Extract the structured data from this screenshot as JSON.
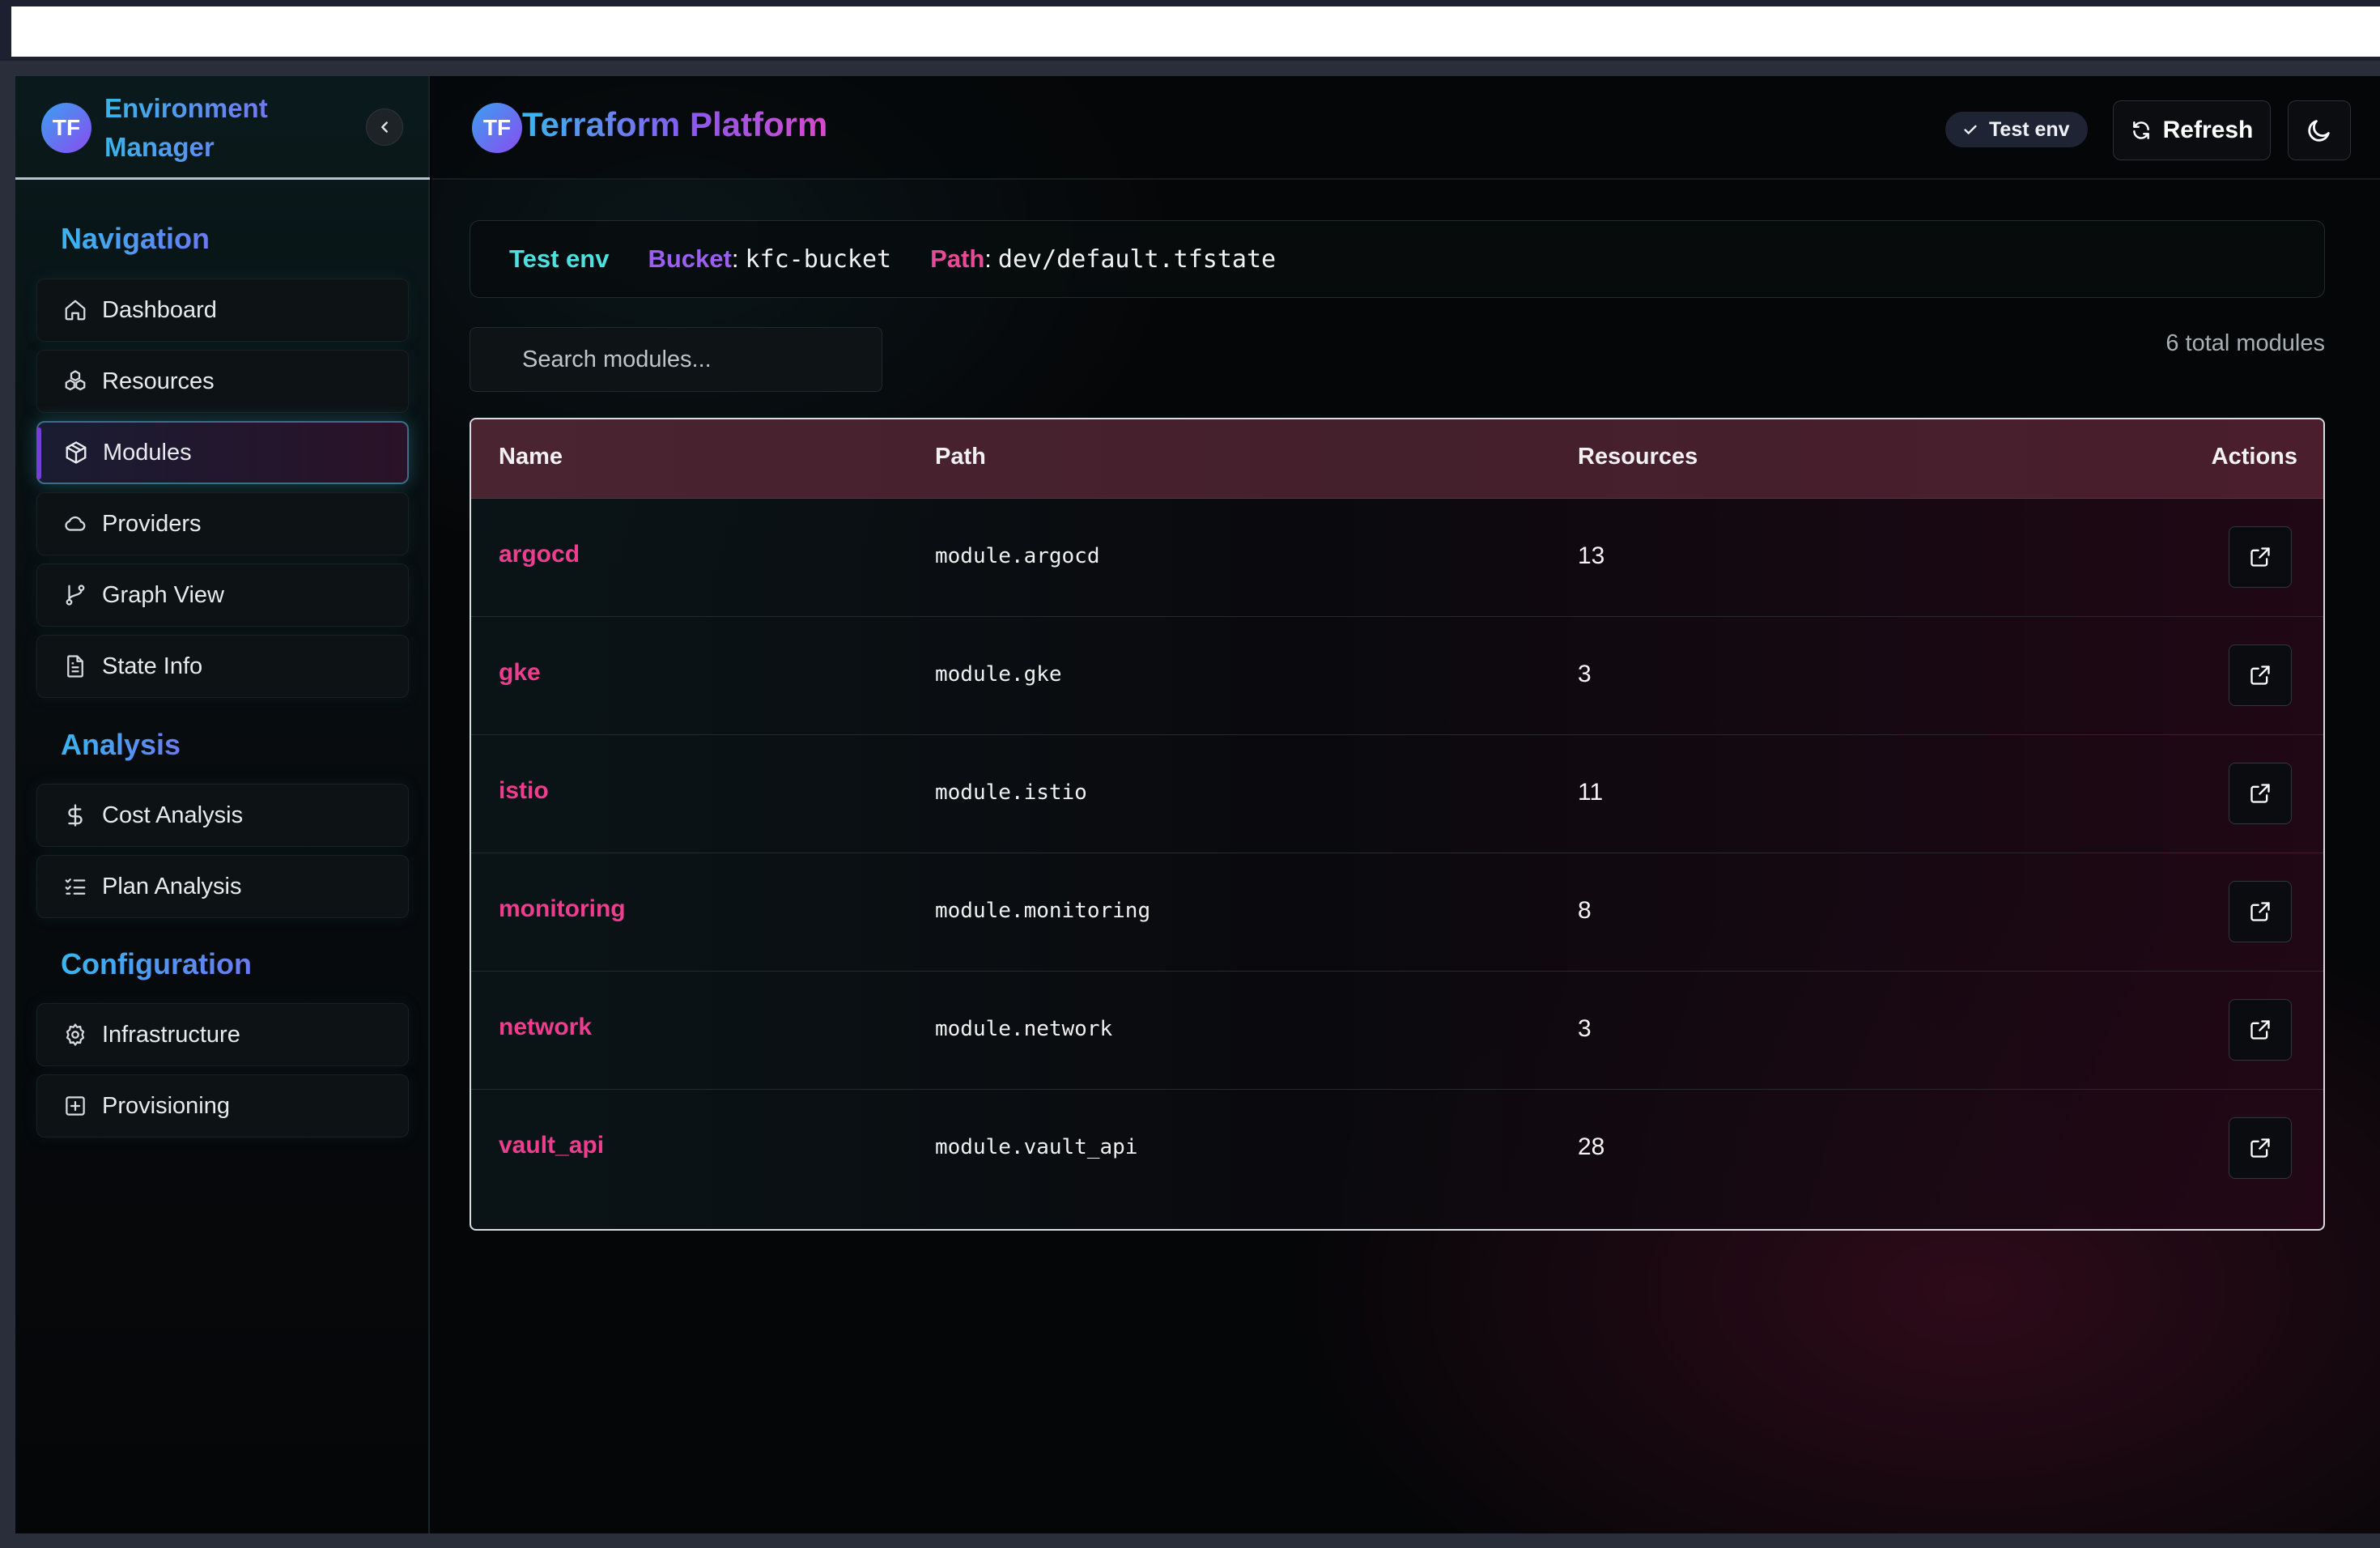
{
  "sidebar": {
    "logo_text": "TF",
    "title": "Environment Manager",
    "sections": [
      {
        "title": "Navigation",
        "items": [
          {
            "label": "Dashboard",
            "icon": "home-icon"
          },
          {
            "label": "Resources",
            "icon": "boxes-icon"
          },
          {
            "label": "Modules",
            "icon": "package-icon",
            "active": true
          },
          {
            "label": "Providers",
            "icon": "cloud-icon"
          },
          {
            "label": "Graph View",
            "icon": "git-branch-icon"
          },
          {
            "label": "State Info",
            "icon": "file-text-icon"
          }
        ]
      },
      {
        "title": "Analysis",
        "items": [
          {
            "label": "Cost Analysis",
            "icon": "dollar-icon"
          },
          {
            "label": "Plan Analysis",
            "icon": "list-checks-icon"
          }
        ]
      },
      {
        "title": "Configuration",
        "items": [
          {
            "label": "Infrastructure",
            "icon": "gear-icon"
          },
          {
            "label": "Provisioning",
            "icon": "plus-square-icon"
          }
        ]
      }
    ]
  },
  "header": {
    "logo_text": "TF",
    "title": "Terraform Platform",
    "env_badge": "Test env",
    "refresh_label": "Refresh"
  },
  "info": {
    "env_name": "Test env",
    "bucket_label": "Bucket",
    "bucket_value": "kfc-bucket",
    "path_label": "Path",
    "path_value": "dev/default.tfstate"
  },
  "search": {
    "placeholder": "Search modules..."
  },
  "total_text": "6 total modules",
  "table": {
    "columns": [
      "Name",
      "Path",
      "Resources",
      "Actions"
    ],
    "rows": [
      {
        "name": "argocd",
        "path": "module.argocd",
        "resources": "13"
      },
      {
        "name": "gke",
        "path": "module.gke",
        "resources": "3"
      },
      {
        "name": "istio",
        "path": "module.istio",
        "resources": "11"
      },
      {
        "name": "monitoring",
        "path": "module.monitoring",
        "resources": "8"
      },
      {
        "name": "network",
        "path": "module.network",
        "resources": "3"
      },
      {
        "name": "vault_api",
        "path": "module.vault_api",
        "resources": "28"
      }
    ]
  },
  "colors": {
    "accent_cyan": "#4ee0e0",
    "accent_purple": "#9a5ef0",
    "accent_pink": "#ee3d8e"
  }
}
